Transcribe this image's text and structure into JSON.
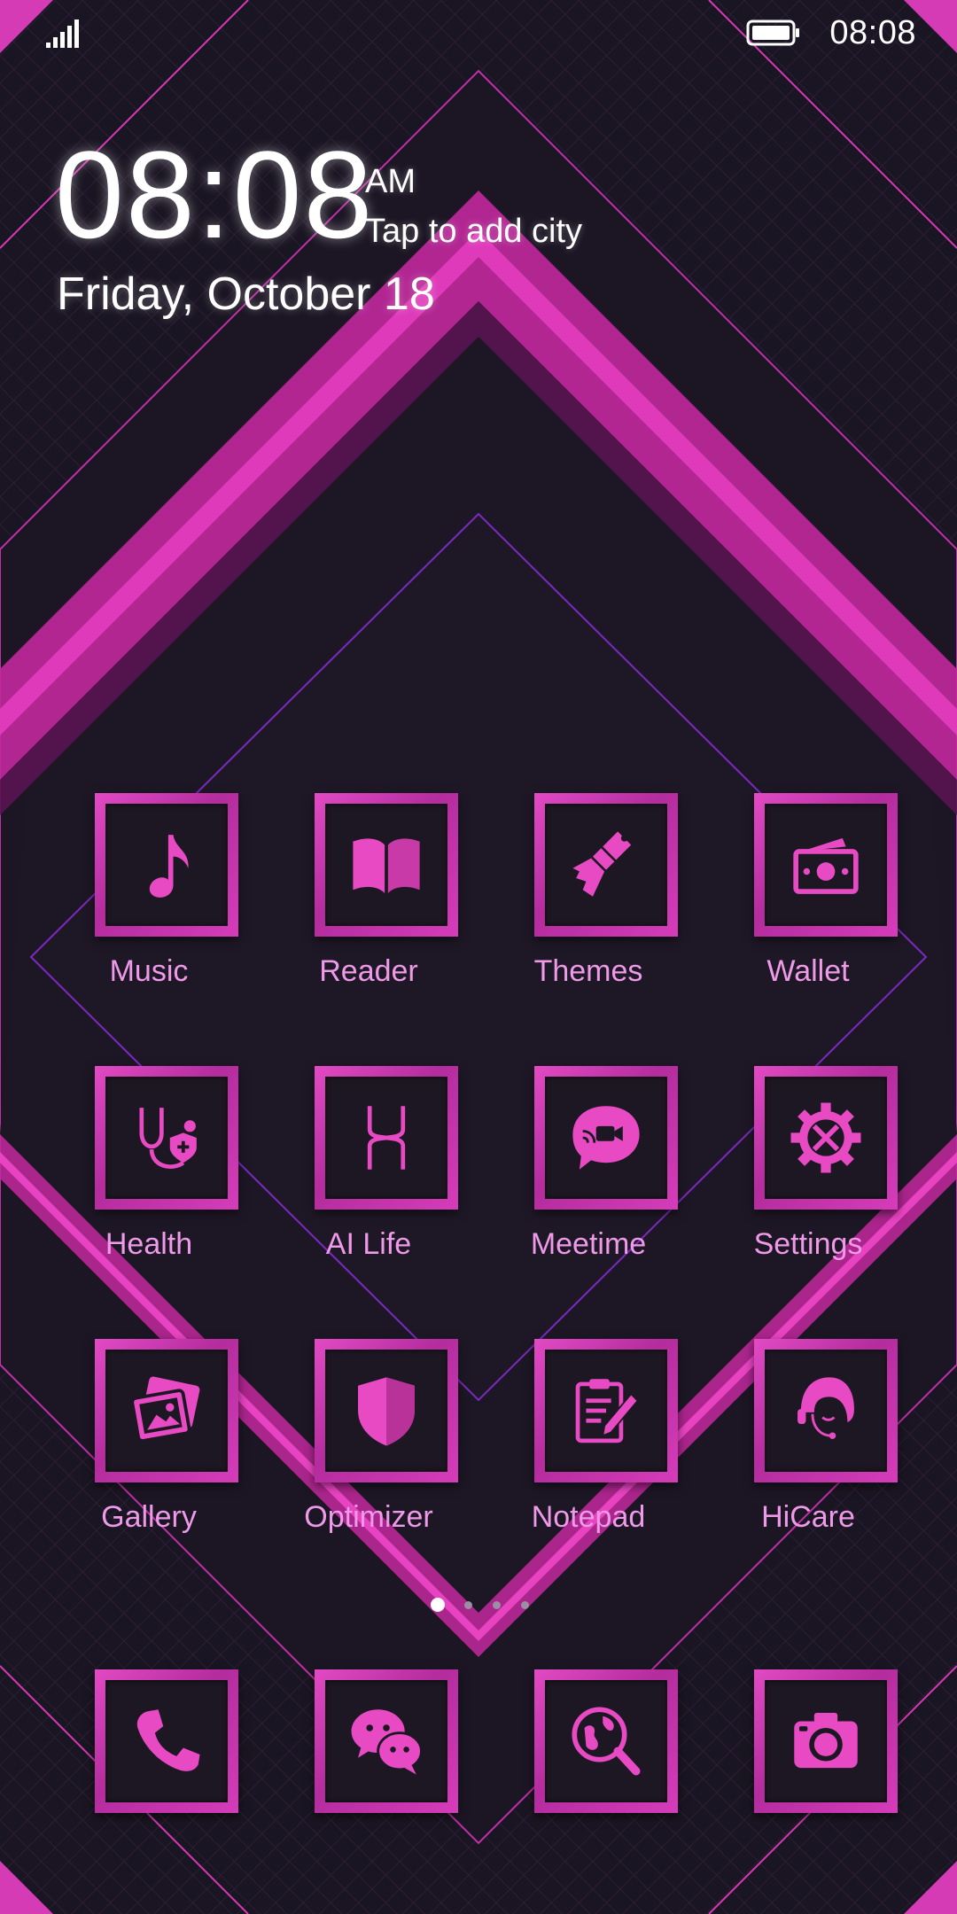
{
  "status_bar": {
    "time": "08:08",
    "signal_icon": "signal-icon",
    "battery_icon": "battery-icon"
  },
  "clock_widget": {
    "time": "08:08",
    "ampm": "AM",
    "city_prompt": "Tap to add city",
    "date": "Friday, October 18"
  },
  "theme": {
    "accent": "#d63cba",
    "label_color": "#ee9ae9",
    "background": "#1a1522"
  },
  "apps": [
    {
      "label": "Music",
      "icon": "music-note-icon"
    },
    {
      "label": "Reader",
      "icon": "book-icon"
    },
    {
      "label": "Themes",
      "icon": "paintbrush-icon"
    },
    {
      "label": "Wallet",
      "icon": "wallet-icon"
    },
    {
      "label": "Health",
      "icon": "stethoscope-icon"
    },
    {
      "label": "AI Life",
      "icon": "ai-life-icon"
    },
    {
      "label": "Meetime",
      "icon": "video-chat-icon"
    },
    {
      "label": "Settings",
      "icon": "gear-icon"
    },
    {
      "label": "Gallery",
      "icon": "gallery-icon"
    },
    {
      "label": "Optimizer",
      "icon": "shield-icon"
    },
    {
      "label": "Notepad",
      "icon": "notepad-icon"
    },
    {
      "label": "HiCare",
      "icon": "headset-icon"
    }
  ],
  "page_indicator": {
    "count": 4,
    "active": 1
  },
  "dock": [
    {
      "icon": "phone-icon"
    },
    {
      "icon": "chat-icon"
    },
    {
      "icon": "browser-icon"
    },
    {
      "icon": "camera-icon"
    }
  ]
}
